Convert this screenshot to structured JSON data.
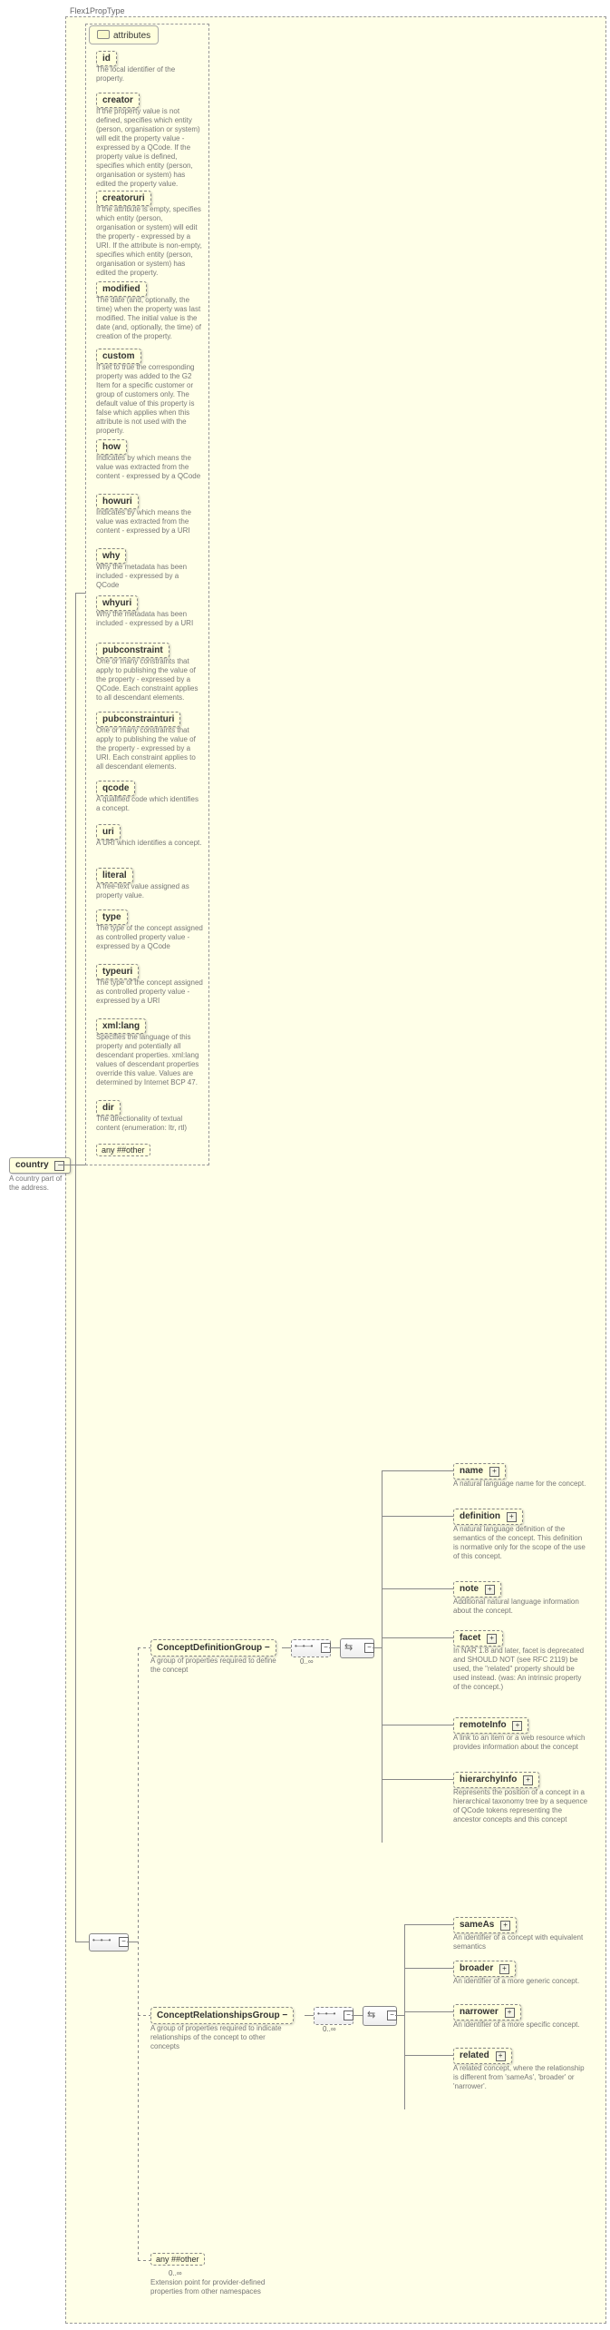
{
  "typeName": "Flex1PropType",
  "mainElement": {
    "name": "country",
    "desc": "A country part of the address."
  },
  "attributesHeader": "attributes",
  "attributes": [
    {
      "name": "id",
      "desc": "The local identifier of the property."
    },
    {
      "name": "creator",
      "desc": "If the property value is not defined, specifies which entity (person, organisation or system) will edit the property value - expressed by a QCode. If the property value is defined, specifies which entity (person, organisation or system) has edited the property value."
    },
    {
      "name": "creatoruri",
      "desc": "If the attribute is empty, specifies which entity (person, organisation or system) will edit the property - expressed by a URI. If the attribute is non-empty, specifies which entity (person, organisation or system) has edited the property."
    },
    {
      "name": "modified",
      "desc": "The date (and, optionally, the time) when the property was last modified. The initial value is the date (and, optionally, the time) of creation of the property."
    },
    {
      "name": "custom",
      "desc": "If set to true the corresponding property was added to the G2 Item for a specific customer or group of customers only. The default value of this property is false which applies when this attribute is not used with the property."
    },
    {
      "name": "how",
      "desc": "Indicates by which means the value was extracted from the content - expressed by a QCode"
    },
    {
      "name": "howuri",
      "desc": "Indicates by which means the value was extracted from the content - expressed by a URI"
    },
    {
      "name": "why",
      "desc": "Why the metadata has been included - expressed by a QCode"
    },
    {
      "name": "whyuri",
      "desc": "Why the metadata has been included - expressed by a URI"
    },
    {
      "name": "pubconstraint",
      "desc": "One or many constraints that apply to publishing the value of the property - expressed by a QCode. Each constraint applies to all descendant elements."
    },
    {
      "name": "pubconstrainturi",
      "desc": "One or many constraints that apply to publishing the value of the property - expressed by a URI. Each constraint applies to all descendant elements."
    },
    {
      "name": "qcode",
      "desc": "A qualified code which identifies a concept."
    },
    {
      "name": "uri",
      "desc": "A URI which identifies a concept."
    },
    {
      "name": "literal",
      "desc": "A free-text value assigned as property value."
    },
    {
      "name": "type",
      "desc": "The type of the concept assigned as controlled property value - expressed by a QCode"
    },
    {
      "name": "typeuri",
      "desc": "The type of the concept assigned as controlled property value - expressed by a URI"
    },
    {
      "name": "xml:lang",
      "desc": "Specifies the language of this property and potentially all descendant properties. xml:lang values of descendant properties override this value. Values are determined by Internet BCP 47."
    },
    {
      "name": "dir",
      "desc": "The directionality of textual content (enumeration: ltr, rtl)"
    }
  ],
  "attrAny": {
    "label": "any ##other"
  },
  "groups": {
    "cdg": {
      "name": "ConceptDefinitionGroup",
      "desc": "A group of properties required to define the concept",
      "card": "0..∞"
    },
    "crg": {
      "name": "ConceptRelationshipsGroup",
      "desc": "A group of properties required to indicate relationships of the concept to other concepts",
      "card": "0..∞"
    }
  },
  "cdgChildren": [
    {
      "name": "name",
      "desc": "A natural language name for the concept."
    },
    {
      "name": "definition",
      "desc": "A natural language definition of the semantics of the concept. This definition is normative only for the scope of the use of this concept."
    },
    {
      "name": "note",
      "desc": "Additional natural language information about the concept."
    },
    {
      "name": "facet",
      "desc": "In NAR 1.8 and later, facet is deprecated and SHOULD NOT (see RFC 2119) be used, the \"related\" property should be used instead. (was: An intrinsic property of the concept.)"
    },
    {
      "name": "remoteInfo",
      "desc": "A link to an item or a web resource which provides information about the concept"
    },
    {
      "name": "hierarchyInfo",
      "desc": "Represents the position of a concept in a hierarchical taxonomy tree by a sequence of QCode tokens representing the ancestor concepts and this concept"
    }
  ],
  "crgChildren": [
    {
      "name": "sameAs",
      "desc": "An identifier of a concept with equivalent semantics"
    },
    {
      "name": "broader",
      "desc": "An identifier of a more generic concept."
    },
    {
      "name": "narrower",
      "desc": "An identifier of a more specific concept."
    },
    {
      "name": "related",
      "desc": "A related concept, where the relationship is different from 'sameAs', 'broader' or 'narrower'."
    }
  ],
  "bottomAny": {
    "label": "any ##other",
    "card": "0..∞",
    "desc": "Extension point for provider-defined properties from other namespaces"
  }
}
